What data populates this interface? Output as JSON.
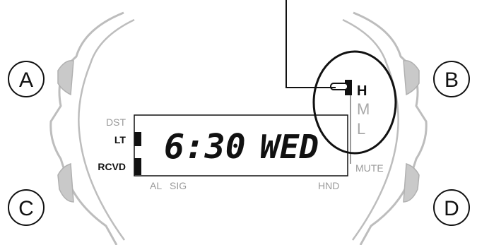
{
  "buttons": {
    "a": "A",
    "b": "B",
    "c": "C",
    "d": "D"
  },
  "indicators": {
    "dst": "DST",
    "lt": "LT",
    "rcvd": "RCVD",
    "al": "AL",
    "sig": "SIG",
    "hnd": "HND",
    "mute": "MUTE"
  },
  "display": {
    "time": "6:30",
    "day": "WED"
  },
  "signal_levels": {
    "high": "H",
    "medium": "M",
    "low": "L",
    "current": "H"
  }
}
